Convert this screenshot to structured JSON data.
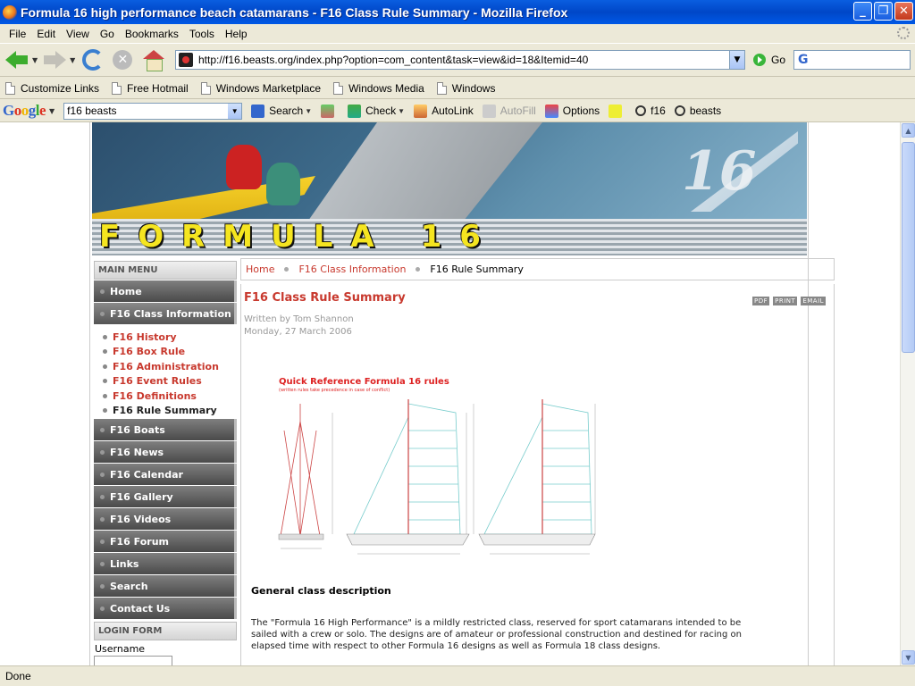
{
  "window": {
    "title": "Formula 16 high performance beach catamarans - F16 Class Rule Summary - Mozilla Firefox"
  },
  "menubar": [
    "File",
    "Edit",
    "View",
    "Go",
    "Bookmarks",
    "Tools",
    "Help"
  ],
  "navbar": {
    "url": "http://f16.beasts.org/index.php?option=com_content&task=view&id=18&Itemid=40",
    "go_label": "Go"
  },
  "bookmarks": [
    "Customize Links",
    "Free Hotmail",
    "Windows Marketplace",
    "Windows Media",
    "Windows"
  ],
  "google_toolbar": {
    "logo": "Google",
    "query": "f16 beasts",
    "search_label": "Search",
    "check_label": "Check",
    "autolink_label": "AutoLink",
    "autofill_label": "AutoFill",
    "options_label": "Options",
    "term1": "f16",
    "term2": "beasts"
  },
  "banner": {
    "wordmark": "FORMULA 16",
    "logo_number": "16"
  },
  "sidebar": {
    "main_menu_header": "MAIN MENU",
    "items": [
      {
        "label": "Home"
      },
      {
        "label": "F16 Class Information"
      },
      {
        "label": "F16 Boats"
      },
      {
        "label": "F16 News"
      },
      {
        "label": "F16 Calendar"
      },
      {
        "label": "F16 Gallery"
      },
      {
        "label": "F16 Videos"
      },
      {
        "label": "F16 Forum"
      },
      {
        "label": "Links"
      },
      {
        "label": "Search"
      },
      {
        "label": "Contact Us"
      }
    ],
    "subitems": [
      {
        "label": "F16 History"
      },
      {
        "label": "F16 Box Rule"
      },
      {
        "label": "F16 Administration"
      },
      {
        "label": "F16 Event Rules"
      },
      {
        "label": "F16 Definitions"
      },
      {
        "label": "F16 Rule Summary"
      }
    ],
    "login_header": "LOGIN FORM",
    "username_label": "Username"
  },
  "breadcrumb": [
    "Home",
    "F16 Class Information",
    "F16 Rule Summary"
  ],
  "article": {
    "title": "F16 Class Rule Summary",
    "icons": [
      "PDF",
      "PRINT",
      "EMAIL"
    ],
    "author": "Written by Tom Shannon",
    "date": "Monday, 27 March 2006",
    "diagram_title": "Quick Reference Formula 16 rules",
    "diagram_subtitle": "(written rules take precedence in case of conflict)",
    "heading": "General class description",
    "paragraph": "The \"Formula 16 High Performance\" is a mildly restricted class, reserved for sport catamarans intended to be sailed with a crew or solo. The designs are of  amateur or professional construction and destined for racing on elapsed time with respect to other Formula 16 designs as well as Formula 18 class designs."
  },
  "status": {
    "text": "Done"
  }
}
